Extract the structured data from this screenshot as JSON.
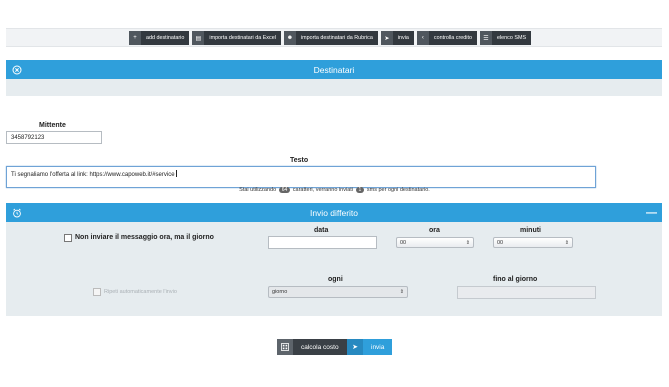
{
  "toolbar": {
    "buttons": [
      {
        "icon": "plus-icon",
        "glyph": "+",
        "label": "add destinatario"
      },
      {
        "icon": "file-excel-icon",
        "glyph": "▤",
        "label": "importa destinatari da Excel"
      },
      {
        "icon": "address-book-icon",
        "glyph": "☻",
        "label": "importa destinatari da Rubrica"
      },
      {
        "icon": "paper-plane-icon",
        "glyph": "➤",
        "label": "invia"
      },
      {
        "icon": "chevron-left-icon",
        "glyph": "‹",
        "label": "controlla credito"
      },
      {
        "icon": "list-icon",
        "glyph": "☰",
        "label": "elenco SMS"
      }
    ]
  },
  "recipients_panel": {
    "title": "Destinatari",
    "icon": "close-circle-icon"
  },
  "form": {
    "sender_label": "Mittente",
    "sender_value": "3458792123",
    "text_label": "Testo",
    "text_value": "Ti segnaliamo l'offerta al link: https://www.capoweb.it/#service",
    "info_prefix": "Stai utilizzando",
    "char_count": "64",
    "info_middle": "caratteri, verranno inviati",
    "sms_count": "1",
    "info_suffix": "sms per ogni destinatario."
  },
  "deferred": {
    "title": "Invio differito",
    "left_icon": "alarm-clock-icon",
    "right_icon": "minus-icon",
    "collapse_glyph": "—",
    "checkbox_label": "Non inviare il messaggio ora, ma il giorno",
    "date_label": "data",
    "date_value": "",
    "hour_label": "ora",
    "hour_value": "00",
    "minutes_label": "minuti",
    "minutes_value": "00",
    "repeat_label": "Ripeti automaticamente l'invio",
    "every_label": "ogni",
    "every_value": "giorno",
    "until_label": "fino al giorno",
    "until_value": ""
  },
  "actions": {
    "calc_label": "calcola costo",
    "calc_icon": "calculator-icon",
    "send_label": "invia",
    "send_icon": "paper-plane-icon"
  },
  "colors": {
    "accent": "#2f9fdb",
    "toolbar_bg": "#33393f",
    "band_bg": "#e6ecef"
  }
}
